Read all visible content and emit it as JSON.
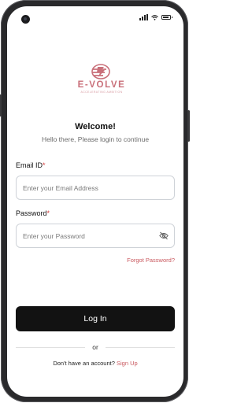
{
  "status_bar": {
    "camera": "front-camera-icon",
    "icons": [
      "signal-icon",
      "wifi-icon",
      "battery-icon"
    ]
  },
  "logo": {
    "name": "E-VOLVE",
    "tagline": "ACCELERATING AMBITION",
    "color": "#c9707a"
  },
  "header": {
    "title": "Welcome!",
    "subtitle": "Hello there, Please login to continue"
  },
  "form": {
    "email": {
      "label": "Email ID",
      "required_mark": "*",
      "placeholder": "Enter your Email Address",
      "value": ""
    },
    "password": {
      "label": "Password",
      "required_mark": "*",
      "placeholder": "Enter your Password",
      "value": "",
      "toggle_icon": "eye-off-icon"
    },
    "forgot_password": "Forgot Password?",
    "submit": "Log In"
  },
  "divider": {
    "text": "or"
  },
  "signup": {
    "prompt": "Don't have an account?",
    "link": "Sign Up"
  },
  "colors": {
    "accent": "#c9595f",
    "button": "#121212",
    "required": "#d33a3a"
  }
}
